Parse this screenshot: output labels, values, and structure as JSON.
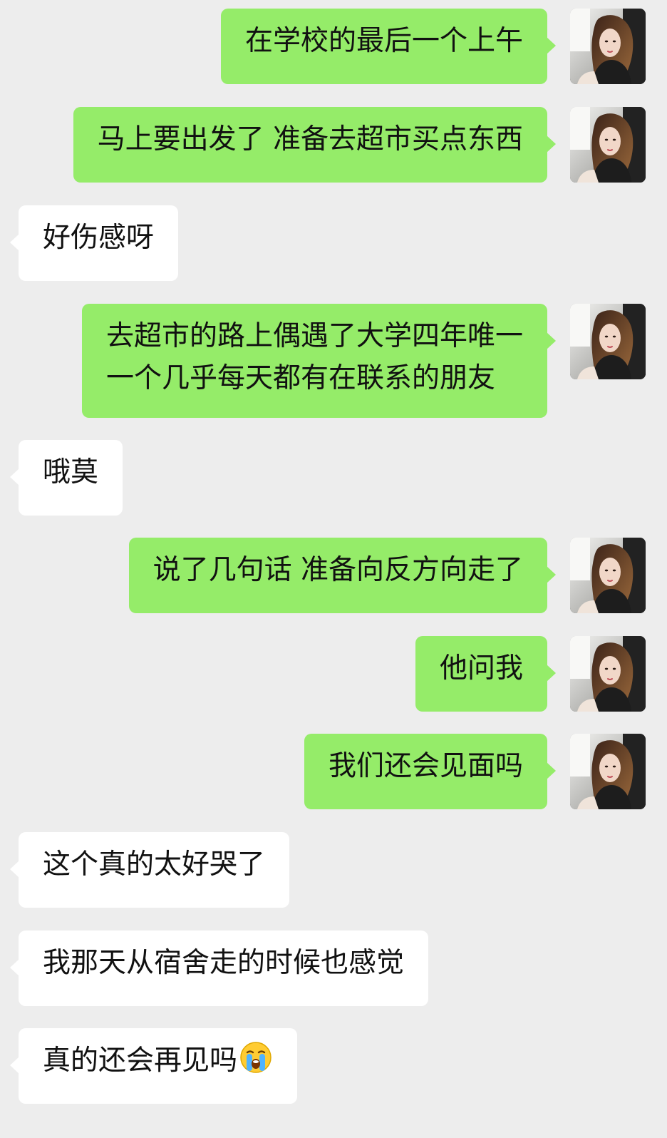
{
  "messages": [
    {
      "side": "out",
      "text": "在学校的最后一个上午"
    },
    {
      "side": "out",
      "text": "马上要出发了 准备去超市买点东西"
    },
    {
      "side": "in",
      "text": "好伤感呀"
    },
    {
      "side": "out",
      "lines": [
        "去超市的路上偶遇了大学四年唯一",
        "一个几乎每天都有在联系的朋友"
      ]
    },
    {
      "side": "in",
      "text": "哦莫"
    },
    {
      "side": "out",
      "text": "说了几句话 准备向反方向走了"
    },
    {
      "side": "out",
      "text": "他问我"
    },
    {
      "side": "out",
      "text": "我们还会见面吗"
    },
    {
      "side": "in",
      "text": "这个真的太好哭了"
    },
    {
      "side": "in",
      "text": "我那天从宿舍走的时候也感觉"
    },
    {
      "side": "in",
      "text": "真的还会再见吗",
      "emoji": "loudly-crying-face-emoji"
    }
  ],
  "colors": {
    "background": "#ededed",
    "outgoing_bubble": "#95ec69",
    "incoming_bubble": "#ffffff",
    "text": "#111111"
  },
  "icons": {
    "avatar": "user-avatar-photo",
    "emoji": "loudly-crying-face-emoji"
  }
}
